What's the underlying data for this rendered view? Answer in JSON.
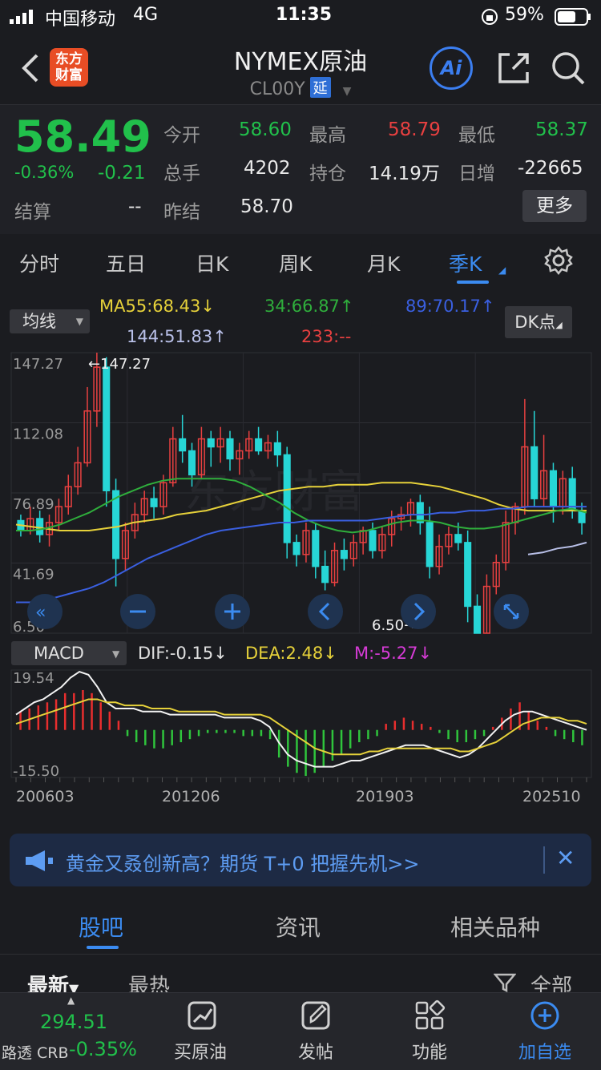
{
  "status_bar": {
    "carrier": "中国移动",
    "network": "4G",
    "time": "11:35",
    "battery": "59%"
  },
  "header": {
    "logo": "东方\n财富",
    "title": "NYMEX原油",
    "code": "CL00Y",
    "badge": "延",
    "ai_label": "Ai"
  },
  "quote": {
    "price": "58.49",
    "change_pct": "-0.36%",
    "change": "-0.21",
    "settle_label": "结算",
    "settle_value": "--",
    "open_label": "今开",
    "open_value": "58.60",
    "high_label": "最高",
    "high_value": "58.79",
    "low_label": "最低",
    "low_value": "58.37",
    "volume_label": "总手",
    "volume_value": "4202",
    "oi_label": "持仓",
    "oi_value": "14.19万",
    "daily_inc_label": "日增",
    "daily_inc_value": "-22665",
    "prev_settle_label": "昨结",
    "prev_settle_value": "58.70",
    "more_label": "更多"
  },
  "period_tabs": [
    "分时",
    "五日",
    "日K",
    "周K",
    "月K",
    "季K"
  ],
  "active_period": "季K",
  "ma_panel": {
    "selector": "均线",
    "dk_label": "DK点",
    "ma55": "MA55:68.43",
    "ma34": "34:66.87",
    "ma89": "89:70.17",
    "ma144": "144:51.83",
    "ma233": "233:--",
    "arrow_down": "↓",
    "arrow_up": "↑"
  },
  "colors": {
    "up": "#e84040",
    "down": "#27d6d6",
    "ma55": "#e6d13a",
    "ma34": "#2fae3c",
    "ma89": "#3a5fe0",
    "ma144": "#b9c0e8",
    "accent": "#3b8bf0"
  },
  "chart_data": [
    {
      "type": "candlestick",
      "title": "",
      "ylim": [
        6.5,
        147.27
      ],
      "y_ticks": [
        "147.27",
        "112.08",
        "76.89",
        "41.69",
        "6.50"
      ],
      "annotations": {
        "max": "←147.27",
        "min": "6.50→"
      },
      "x_ticks": [
        "200603",
        "201206",
        "201903",
        "202510"
      ],
      "series": [
        {
          "name": "MA55",
          "values": [
            61,
            60,
            59,
            58,
            58,
            58,
            59,
            60,
            62,
            63,
            64,
            66,
            67,
            68,
            70,
            72,
            74,
            76,
            78,
            79,
            80,
            80,
            81,
            81,
            81,
            82,
            82,
            82,
            81,
            80,
            78,
            76,
            74,
            71,
            69,
            68,
            68,
            68,
            68,
            68
          ]
        },
        {
          "name": "34",
          "values": [
            58,
            58,
            59,
            61,
            64,
            67,
            71,
            75,
            78,
            81,
            83,
            84,
            84,
            84,
            84,
            83,
            80,
            76,
            72,
            67,
            63,
            60,
            58,
            57,
            58,
            60,
            62,
            63,
            63,
            62,
            60,
            59,
            59,
            60,
            62,
            64,
            66,
            68,
            69,
            67
          ]
        },
        {
          "name": "89",
          "values": [
            22,
            22,
            23,
            25,
            27,
            29,
            32,
            36,
            40,
            44,
            47,
            50,
            53,
            56,
            58,
            59,
            60,
            61,
            62,
            62,
            63,
            63,
            63,
            63,
            63,
            64,
            65,
            66,
            66,
            67,
            67,
            68,
            68,
            69,
            69,
            70,
            70,
            70,
            70,
            70
          ]
        },
        {
          "name": "144",
          "values": [
            null,
            null,
            null,
            null,
            null,
            null,
            null,
            null,
            null,
            null,
            null,
            null,
            null,
            null,
            null,
            null,
            null,
            null,
            null,
            null,
            null,
            null,
            null,
            null,
            null,
            null,
            null,
            null,
            null,
            null,
            null,
            null,
            null,
            null,
            null,
            46,
            47,
            49,
            50,
            52
          ]
        }
      ],
      "candles": [
        [
          63,
          58,
          66,
          55
        ],
        [
          58,
          64,
          70,
          56
        ],
        [
          64,
          56,
          68,
          52
        ],
        [
          56,
          62,
          66,
          50
        ],
        [
          62,
          70,
          74,
          58
        ],
        [
          70,
          80,
          86,
          66
        ],
        [
          80,
          92,
          100,
          76
        ],
        [
          92,
          118,
          130,
          90
        ],
        [
          118,
          140,
          147.27,
          110
        ],
        [
          140,
          78,
          145,
          70
        ],
        [
          78,
          44,
          84,
          30
        ],
        [
          44,
          58,
          62,
          38
        ],
        [
          58,
          66,
          72,
          54
        ],
        [
          66,
          74,
          78,
          62
        ],
        [
          74,
          70,
          80,
          64
        ],
        [
          70,
          82,
          86,
          66
        ],
        [
          82,
          104,
          110,
          80
        ],
        [
          104,
          98,
          116,
          92
        ],
        [
          98,
          86,
          102,
          80
        ],
        [
          86,
          104,
          110,
          84
        ],
        [
          104,
          100,
          108,
          90
        ],
        [
          100,
          104,
          110,
          92
        ],
        [
          104,
          94,
          108,
          88
        ],
        [
          94,
          98,
          102,
          86
        ],
        [
          98,
          104,
          108,
          94
        ],
        [
          104,
          98,
          110,
          96
        ],
        [
          98,
          102,
          106,
          94
        ],
        [
          102,
          96,
          108,
          90
        ],
        [
          96,
          52,
          100,
          44
        ],
        [
          52,
          46,
          56,
          40
        ],
        [
          46,
          58,
          62,
          42
        ],
        [
          58,
          40,
          62,
          34
        ],
        [
          40,
          32,
          48,
          28
        ],
        [
          32,
          48,
          52,
          30
        ],
        [
          48,
          44,
          54,
          38
        ],
        [
          44,
          52,
          56,
          40
        ],
        [
          52,
          58,
          60,
          46
        ],
        [
          58,
          48,
          62,
          44
        ],
        [
          48,
          56,
          60,
          44
        ],
        [
          56,
          64,
          68,
          50
        ],
        [
          64,
          66,
          70,
          58
        ],
        [
          66,
          72,
          74,
          60
        ],
        [
          72,
          62,
          76,
          56
        ],
        [
          62,
          40,
          70,
          34
        ],
        [
          40,
          50,
          56,
          36
        ],
        [
          50,
          56,
          60,
          46
        ],
        [
          56,
          52,
          62,
          48
        ],
        [
          52,
          20,
          58,
          12
        ],
        [
          20,
          6.5,
          26,
          6.5
        ],
        [
          6.5,
          30,
          36,
          6.5
        ],
        [
          30,
          42,
          46,
          26
        ],
        [
          42,
          62,
          68,
          38
        ],
        [
          62,
          70,
          72,
          56
        ],
        [
          70,
          100,
          124,
          66
        ],
        [
          100,
          74,
          118,
          70
        ],
        [
          74,
          88,
          106,
          70
        ],
        [
          88,
          70,
          92,
          62
        ],
        [
          70,
          84,
          88,
          66
        ],
        [
          84,
          68,
          90,
          64
        ],
        [
          68,
          62,
          72,
          56
        ]
      ]
    },
    {
      "type": "bar",
      "title": "",
      "ylim": [
        -15.5,
        19.54
      ],
      "y_ticks": [
        "19.54",
        "-15.50"
      ],
      "macd_selector": "MACD",
      "dif_label": "DIF:-0.15",
      "dea_label": "DEA:2.48",
      "m_label": "M:-5.27",
      "arrow": "↓",
      "series": [
        {
          "name": "M",
          "values": [
            6,
            7,
            8,
            9,
            10,
            12,
            12,
            13,
            12,
            9,
            6,
            3,
            -2,
            -4,
            -5,
            -6,
            -6,
            -5,
            -4,
            -3,
            -2,
            -1,
            -1,
            -1,
            -1,
            -2,
            -2,
            -2,
            -3,
            -9,
            -12,
            -14,
            -15,
            -14,
            -12,
            -10,
            -8,
            -6,
            -4,
            -3,
            -2,
            2,
            3,
            4,
            3,
            2,
            1,
            -1,
            -3,
            -4,
            -4,
            -3,
            -2,
            1,
            4,
            7,
            9,
            6,
            3,
            1,
            -2,
            -3,
            -4,
            -5
          ]
        },
        {
          "name": "DIF",
          "values": [
            5,
            7,
            9,
            10,
            12,
            14,
            17,
            19,
            18,
            14,
            9,
            7,
            7,
            7,
            6,
            6,
            6,
            5,
            5,
            5,
            5,
            5,
            5,
            4,
            4,
            4,
            4,
            3,
            1,
            -4,
            -8,
            -10,
            -11,
            -12,
            -12,
            -12,
            -11,
            -10,
            -10,
            -9,
            -8,
            -7,
            -6,
            -5,
            -5,
            -5,
            -6,
            -7,
            -8,
            -9,
            -8,
            -6,
            -3,
            0,
            3,
            5,
            6,
            6,
            5,
            4,
            3,
            2,
            1,
            0
          ]
        },
        {
          "name": "DEA",
          "values": [
            2,
            3,
            4,
            5,
            6,
            7,
            8,
            9,
            10,
            10,
            9,
            9,
            8,
            8,
            8,
            7,
            7,
            7,
            6,
            6,
            6,
            6,
            6,
            5,
            5,
            5,
            5,
            5,
            4,
            2,
            0,
            -2,
            -4,
            -6,
            -7,
            -8,
            -8,
            -8,
            -8,
            -7,
            -7,
            -6,
            -6,
            -6,
            -6,
            -6,
            -6,
            -6,
            -6,
            -7,
            -7,
            -6,
            -5,
            -4,
            -2,
            0,
            2,
            3,
            4,
            4,
            4,
            3,
            3,
            2
          ]
        }
      ],
      "x_ticks": [
        "200603",
        "201206",
        "201903",
        "202510"
      ]
    }
  ],
  "banner": {
    "text": "黄金又叒创新高？期货 T+0 把握先机>>"
  },
  "lower_tabs": [
    "股吧",
    "资讯",
    "相关品种"
  ],
  "active_lower_tab": "股吧",
  "sort": {
    "latest": "最新",
    "hot": "最热",
    "all": "全部"
  },
  "bottom_bar": {
    "ticker_value": "294.51",
    "ticker_name": "路透 CRB",
    "ticker_change": "-0.35%",
    "items": [
      "买原油",
      "发帖",
      "功能",
      "加自选"
    ]
  }
}
